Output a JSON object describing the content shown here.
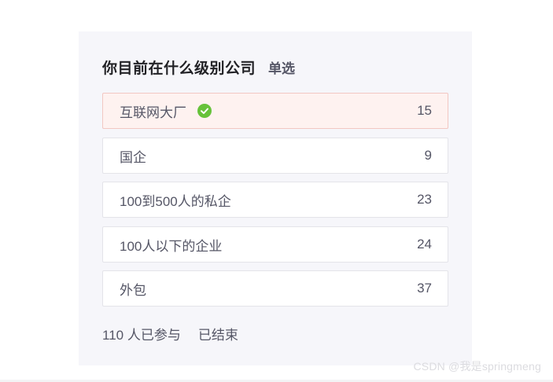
{
  "poll": {
    "title": "你目前在什么级别公司",
    "type_label": "单选",
    "options": [
      {
        "label": "互联网大厂",
        "count": "15",
        "selected": true
      },
      {
        "label": "国企",
        "count": "9",
        "selected": false
      },
      {
        "label": "100到500人的私企",
        "count": "23",
        "selected": false
      },
      {
        "label": "100人以下的企业",
        "count": "24",
        "selected": false
      },
      {
        "label": "外包",
        "count": "37",
        "selected": false
      }
    ],
    "participants": "110 人已参与",
    "status": "已结束"
  },
  "watermark": "CSDN @我是springmeng",
  "colors": {
    "check_green": "#67c23a",
    "selected_bg": "#fef2f0",
    "card_bg": "#f6f6fa"
  },
  "icons": {
    "selected_marker": "check-circle-icon"
  }
}
